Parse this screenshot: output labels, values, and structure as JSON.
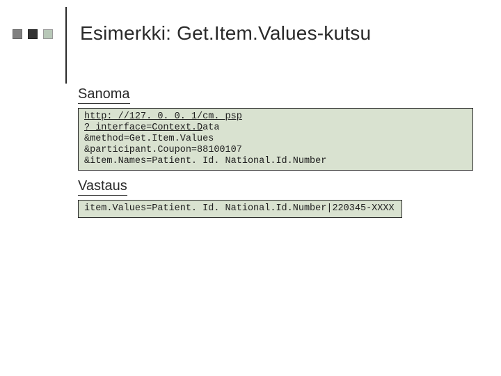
{
  "title": "Esimerkki: Get.Item.Values-kutsu",
  "request": {
    "heading": "Sanoma",
    "line1a": "http: //127. 0. 0. 1/cm. psp",
    "line2a": "? interface=Context.D",
    "line2b": "ata",
    "line3": "&method=Get.Item.Values",
    "line4": "&participant.Coupon=88100107",
    "line5": "&item.Names=Patient. Id. National.Id.Number"
  },
  "response": {
    "heading": "Vastaus",
    "line1": "item.Values=Patient. Id. National.Id.Number|220345-XXXX"
  }
}
